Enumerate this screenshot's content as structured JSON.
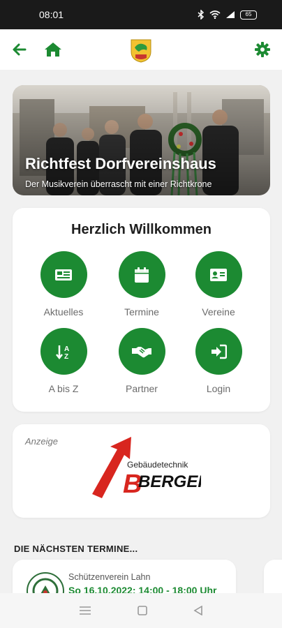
{
  "status_bar": {
    "time": "08:01",
    "battery": "65"
  },
  "colors": {
    "accent": "#1c8a32",
    "background": "#f1f1f1",
    "card": "#ffffff"
  },
  "app_bar": {
    "back_icon": "arrow-left-icon",
    "home_icon": "home-icon",
    "crest_icon": "municipal-crest-icon",
    "settings_icon": "gear-icon"
  },
  "hero": {
    "title": "Richtfest Dorfvereinshaus",
    "subtitle": "Der Musikverein überrascht mit einer Richtkrone"
  },
  "welcome": {
    "title": "Herzlich Willkommen",
    "tiles": [
      {
        "label": "Aktuelles",
        "icon": "newspaper-icon"
      },
      {
        "label": "Termine",
        "icon": "calendar-icon"
      },
      {
        "label": "Vereine",
        "icon": "id-card-icon"
      },
      {
        "label": "A bis Z",
        "icon": "sort-az-icon"
      },
      {
        "label": "Partner",
        "icon": "handshake-icon"
      },
      {
        "label": "Login",
        "icon": "sign-in-icon"
      }
    ]
  },
  "ad": {
    "label": "Anzeige",
    "logo_line1": "Gebäudetechnik",
    "logo_line2": "BERGER"
  },
  "events": {
    "heading": "DIE NÄCHSTEN TERMINE...",
    "items": [
      {
        "club": "Schützenverein Lahn",
        "date": "So 16.10.2022: 14:00 - 18:00 Uhr"
      }
    ]
  },
  "nav": {
    "menu_icon": "menu-icon",
    "home_icon": "square-icon",
    "back_icon": "triangle-back-icon"
  }
}
